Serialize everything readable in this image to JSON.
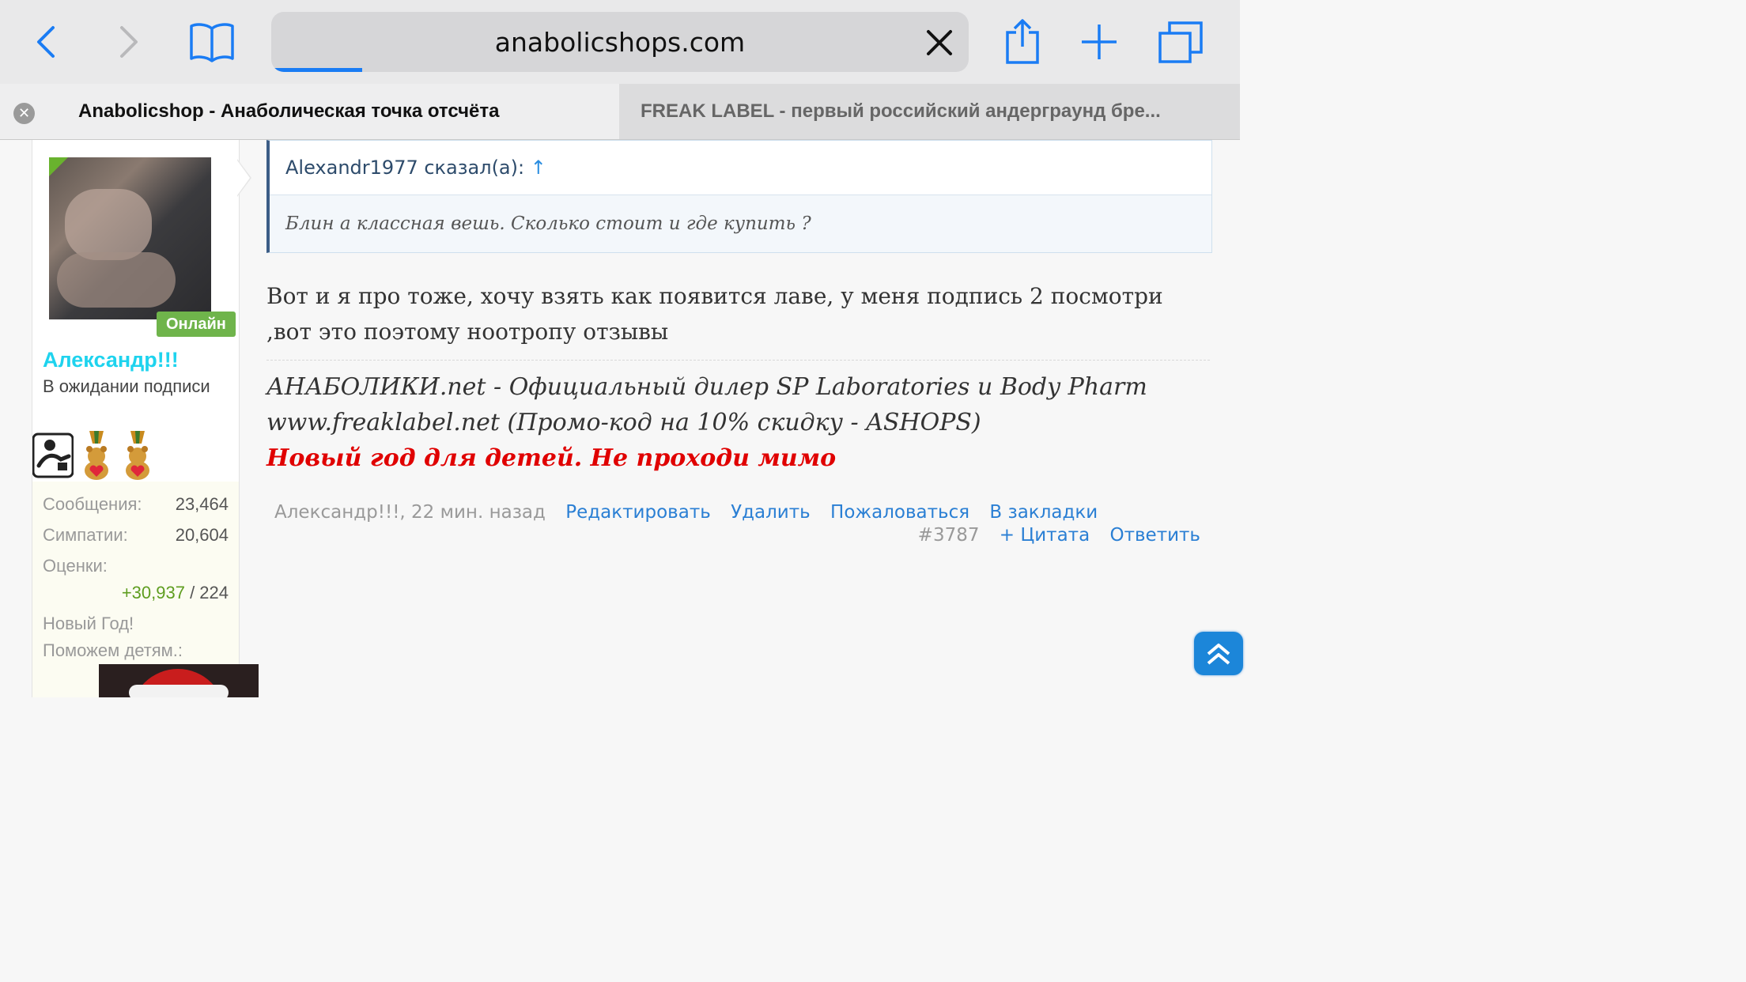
{
  "browser": {
    "url": "anabolicshops.com",
    "load_progress": 0.13,
    "accent_color": "#1a7cf4",
    "icons": [
      "back-icon",
      "forward-icon",
      "bookmarks-icon",
      "clear-icon",
      "share-icon",
      "new-tab-icon",
      "tabs-icon"
    ]
  },
  "tabs": [
    {
      "title": "Anabolicshop - Анаболическая точка отсчёта",
      "active": true
    },
    {
      "title": "FREAK LABEL - первый российский андерграунд бре...",
      "active": false
    }
  ],
  "user": {
    "status_badge": "Онлайн",
    "name": "Александр!!!",
    "title": "В ожидании подписи",
    "name_color": "#1ed3ee",
    "stats": {
      "messages_label": "Сообщения:",
      "messages": "23,464",
      "likes_label": "Симпатии:",
      "likes": "20,604",
      "ratings_label": "Оценки:",
      "ratings_plus": "+30,937",
      "ratings_rest": " / 224",
      "ny_label": "Новый Год!",
      "help_label": "Поможем детям.:"
    }
  },
  "quote": {
    "author_text": "Alexandr1977 сказал(а): ",
    "up_arrow": "↑",
    "text": "Блин а классная вешь. Сколько стоит и где купить ?"
  },
  "message": {
    "text": "Вот и я про тоже, хочу взять как появится лаве, у меня подпись 2 посмотри ,вот это поэтому ноотропу отзывы"
  },
  "signature": {
    "line1": "АНАБОЛИКИ.net - Официальный дилер SP Laboratories и Body Pharm",
    "line2": "www.freaklabel.net (Промо-код на 10% скидку - ASHOPS)",
    "line3": "Новый год для детей. Не проходи мимо",
    "line3_color": "#e00000"
  },
  "post_meta": {
    "author_time": "Александр!!!, 22 мин. назад",
    "edit": "Редактировать",
    "delete": "Удалить",
    "report": "Пожаловаться",
    "bookmark": "В закладки",
    "post_number": "#3787",
    "quote": "+ Цитата",
    "reply": "Ответить"
  }
}
